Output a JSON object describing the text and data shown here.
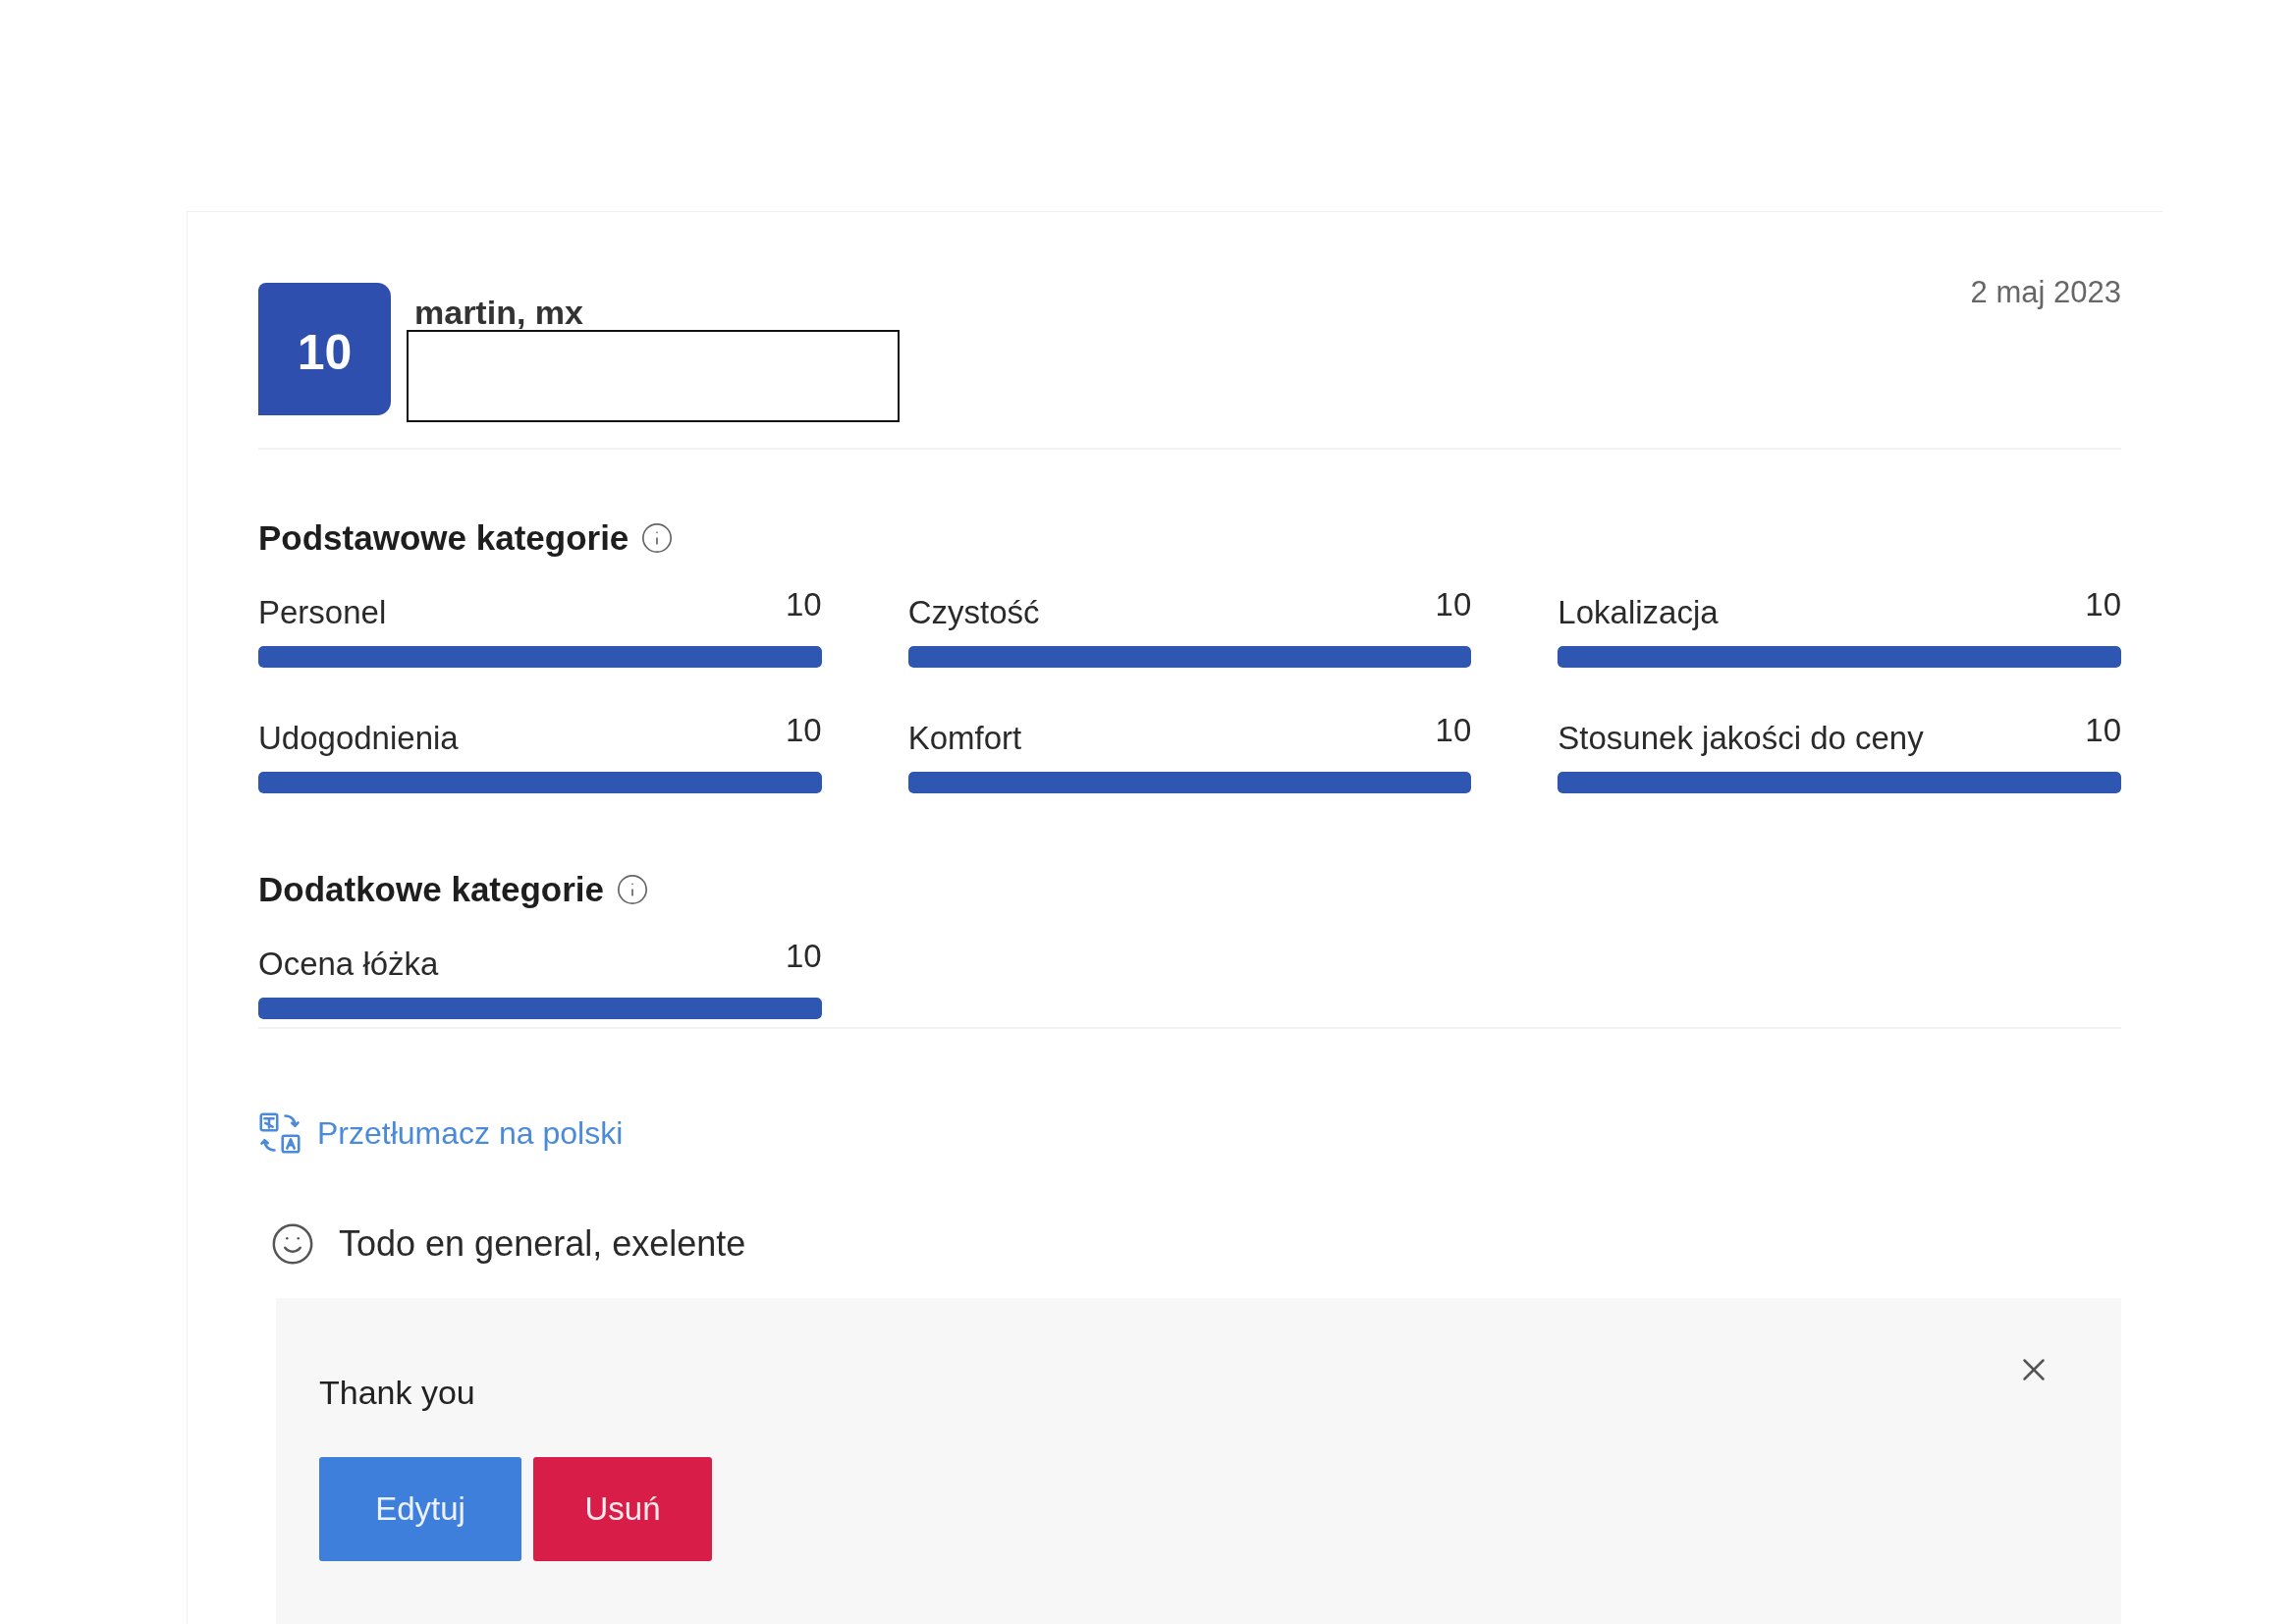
{
  "review": {
    "score": "10",
    "reviewer": "martin, mx",
    "date": "2 maj 2023",
    "sections": [
      {
        "title": "Podstawowe kategorie",
        "categories": [
          {
            "name": "Personel",
            "score": "10",
            "level": 1
          },
          {
            "name": "Czystość",
            "score": "10",
            "level": 1
          },
          {
            "name": "Lokalizacja",
            "score": "10",
            "level": 1
          },
          {
            "name": "Udogodnienia",
            "score": "10",
            "level": 1
          },
          {
            "name": "Komfort",
            "score": "10",
            "level": 1
          },
          {
            "name": "Stosunek jakości do ceny",
            "score": "10",
            "level": 1
          }
        ]
      },
      {
        "title": "Dodatkowe kategorie",
        "categories": [
          {
            "name": "Ocena łóżka",
            "score": "10",
            "level": 1
          }
        ]
      }
    ],
    "translate_link": "Przetłumacz na polski",
    "comments": [
      {
        "kind": "positive",
        "text": "Todo en general, exelente"
      }
    ],
    "reply": {
      "text": "Thank you",
      "buttons": [
        {
          "kind": "edit",
          "label": "Edytuj"
        },
        {
          "kind": "delete",
          "label": "Usuń"
        }
      ]
    }
  }
}
